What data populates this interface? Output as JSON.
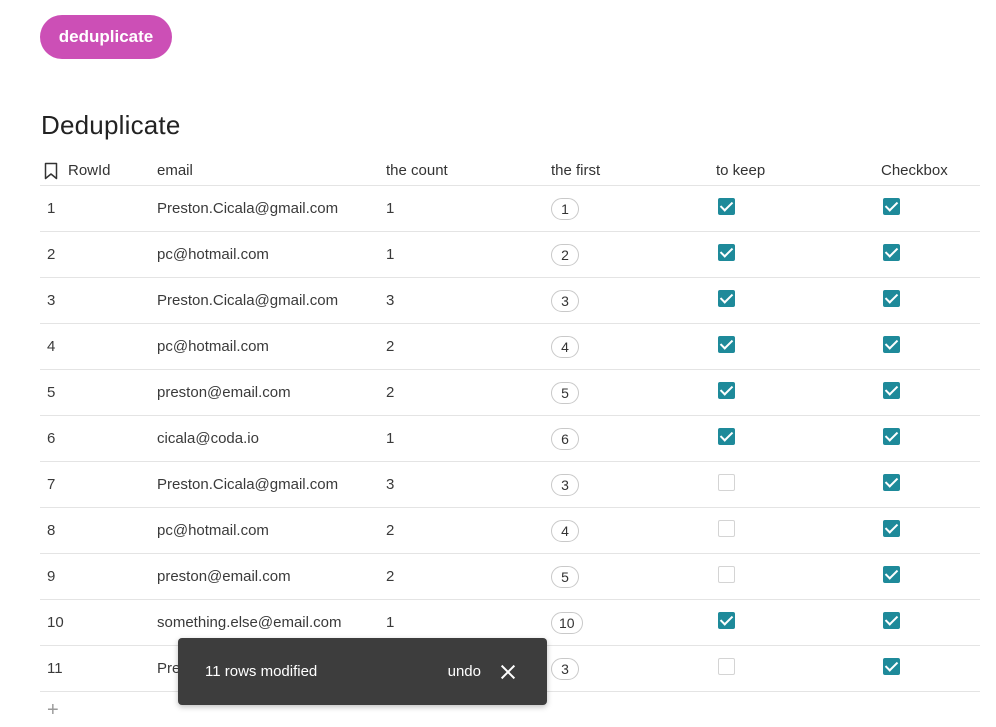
{
  "button": {
    "label": "deduplicate"
  },
  "table": {
    "title": "Deduplicate",
    "columns": [
      "RowId",
      "email",
      "the count",
      "the first",
      "to keep",
      "Checkbox"
    ],
    "rows": [
      {
        "rowid": "1",
        "email": "Preston.Cicala@gmail.com",
        "count": "1",
        "first": "1",
        "keep": true,
        "check": true
      },
      {
        "rowid": "2",
        "email": "pc@hotmail.com",
        "count": "1",
        "first": "2",
        "keep": true,
        "check": true
      },
      {
        "rowid": "3",
        "email": "Preston.Cicala@gmail.com",
        "count": "3",
        "first": "3",
        "keep": true,
        "check": true
      },
      {
        "rowid": "4",
        "email": "pc@hotmail.com",
        "count": "2",
        "first": "4",
        "keep": true,
        "check": true
      },
      {
        "rowid": "5",
        "email": "preston@email.com",
        "count": "2",
        "first": "5",
        "keep": true,
        "check": true
      },
      {
        "rowid": "6",
        "email": "cicala@coda.io",
        "count": "1",
        "first": "6",
        "keep": true,
        "check": true
      },
      {
        "rowid": "7",
        "email": "Preston.Cicala@gmail.com",
        "count": "3",
        "first": "3",
        "keep": false,
        "check": true
      },
      {
        "rowid": "8",
        "email": "pc@hotmail.com",
        "count": "2",
        "first": "4",
        "keep": false,
        "check": true
      },
      {
        "rowid": "9",
        "email": "preston@email.com",
        "count": "2",
        "first": "5",
        "keep": false,
        "check": true
      },
      {
        "rowid": "10",
        "email": "something.else@email.com",
        "count": "1",
        "first": "10",
        "keep": true,
        "check": true
      },
      {
        "rowid": "11",
        "email": "Pre",
        "count": "",
        "first": "3",
        "keep": false,
        "check": true
      }
    ],
    "add_row_label": "+"
  },
  "toast": {
    "message": "11 rows modified",
    "undo_label": "undo"
  },
  "colors": {
    "button": "#cc4fb6",
    "checkbox": "#1e8a9a",
    "toast_bg": "#3d3d3d"
  }
}
